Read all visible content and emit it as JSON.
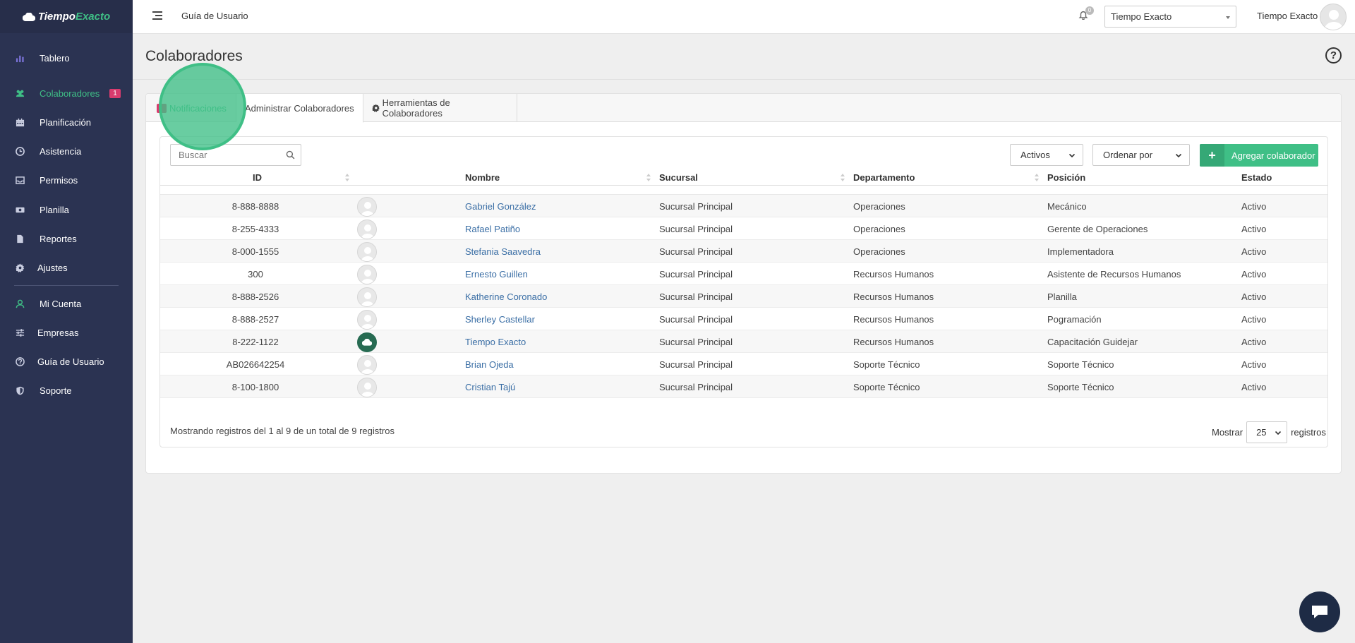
{
  "brand": {
    "part1": "Tiempo",
    "part2": "Exacto",
    "accent_color": "#3fbf86"
  },
  "sidebar": {
    "items": [
      {
        "label": "Tablero",
        "icon": "bar-chart-icon"
      },
      {
        "label": "Colaboradores",
        "icon": "users-icon",
        "badge": "1"
      },
      {
        "label": "Planificación",
        "icon": "calendar-icon"
      },
      {
        "label": "Asistencia",
        "icon": "clock-icon"
      },
      {
        "label": "Permisos",
        "icon": "inbox-icon"
      },
      {
        "label": "Planilla",
        "icon": "money-icon"
      },
      {
        "label": "Reportes",
        "icon": "file-icon"
      },
      {
        "label": "Ajustes",
        "icon": "gear-icon"
      },
      {
        "label": "Mi Cuenta",
        "icon": "user-icon"
      },
      {
        "label": "Empresas",
        "icon": "sliders-icon"
      },
      {
        "label": "Guía de Usuario",
        "icon": "question-icon"
      },
      {
        "label": "Soporte",
        "icon": "shield-icon"
      }
    ]
  },
  "topbar": {
    "guide_link": "Guía de Usuario",
    "notification_count": "0",
    "company_selected": "Tiempo Exacto",
    "user_name": "Tiempo Exacto"
  },
  "page": {
    "title": "Colaboradores",
    "help": "?"
  },
  "tabs": [
    {
      "label": "Notificaciones"
    },
    {
      "label": "Administrar Colaboradores"
    },
    {
      "label": "Herramientas de Colaboradores"
    }
  ],
  "toolbar": {
    "search_placeholder": "Buscar",
    "status_filter": "Activos",
    "order_by": "Ordenar por",
    "add_label": "Agregar colaborador"
  },
  "table": {
    "columns": [
      "ID",
      "Nombre",
      "Sucursal",
      "Departamento",
      "Posición",
      "Estado"
    ],
    "rows": [
      {
        "id": "8-888-8888",
        "name": "Gabriel González",
        "branch": "Sucursal Principal",
        "dept": "Operaciones",
        "position": "Mecánico",
        "status": "Activo"
      },
      {
        "id": "8-255-4333",
        "name": "Rafael Patiño",
        "branch": "Sucursal Principal",
        "dept": "Operaciones",
        "position": "Gerente de Operaciones",
        "status": "Activo"
      },
      {
        "id": "8-000-1555",
        "name": "Stefania Saavedra",
        "branch": "Sucursal Principal",
        "dept": "Operaciones",
        "position": "Implementadora",
        "status": "Activo"
      },
      {
        "id": "300",
        "name": "Ernesto Guillen",
        "branch": "Sucursal Principal",
        "dept": "Recursos Humanos",
        "position": "Asistente de Recursos Humanos",
        "status": "Activo"
      },
      {
        "id": "8-888-2526",
        "name": "Katherine Coronado",
        "branch": "Sucursal Principal",
        "dept": "Recursos Humanos",
        "position": "Planilla",
        "status": "Activo"
      },
      {
        "id": "8-888-2527",
        "name": "Sherley Castellar",
        "branch": "Sucursal Principal",
        "dept": "Recursos Humanos",
        "position": "Pogramación",
        "status": "Activo"
      },
      {
        "id": "8-222-1122",
        "name": "Tiempo Exacto",
        "branch": "Sucursal Principal",
        "dept": "Recursos Humanos",
        "position": "Capacitación Guidejar",
        "status": "Activo"
      },
      {
        "id": "AB026642254",
        "name": "Brian Ojeda",
        "branch": "Sucursal Principal",
        "dept": "Soporte Técnico",
        "position": "Soporte Técnico",
        "status": "Activo"
      },
      {
        "id": "8-100-1800",
        "name": "Cristian Tajú",
        "branch": "Sucursal Principal",
        "dept": "Soporte Técnico",
        "position": "Soporte Técnico",
        "status": "Activo"
      }
    ]
  },
  "footer": {
    "info": "Mostrando registros del 1 al 9 de un total de 9 registros",
    "show_label": "Mostrar",
    "page_size": "25",
    "records_label": "registros"
  }
}
